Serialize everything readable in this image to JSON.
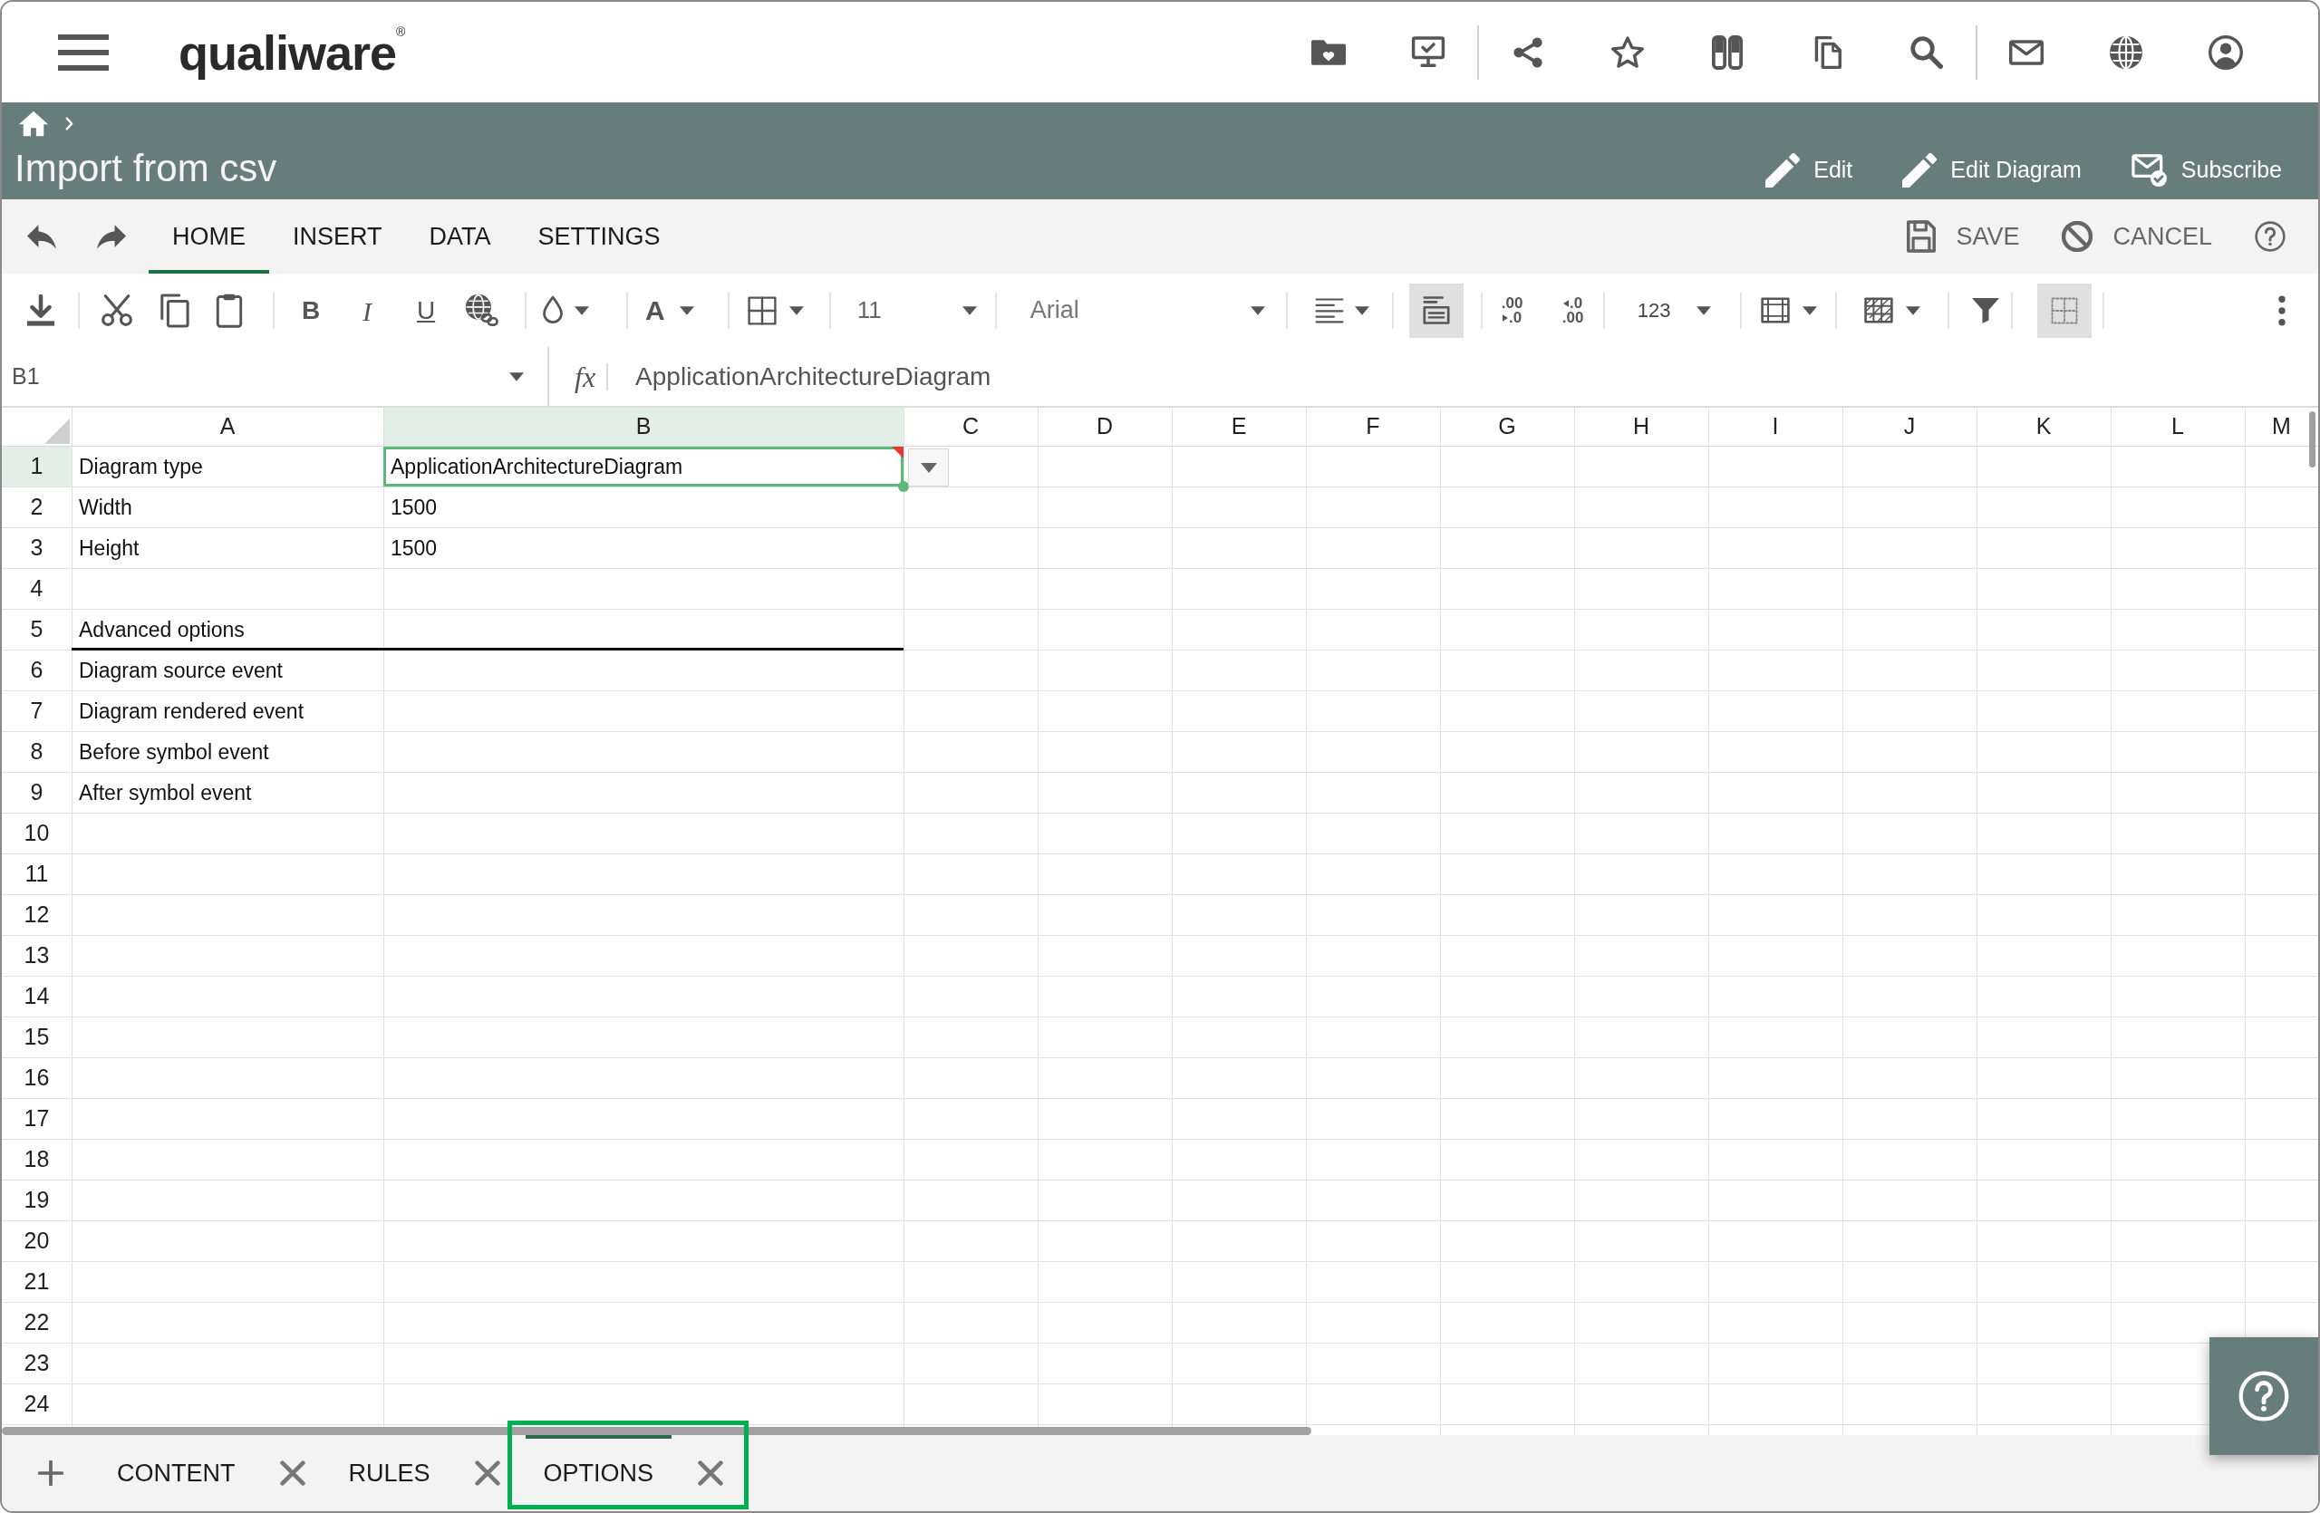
{
  "app_bar": {
    "logo": "qualiware$^{®}$"
  },
  "page_header": {
    "title": "Import from csv",
    "actions": [
      {
        "label": "Edit"
      },
      {
        "label": "Edit Diagram"
      },
      {
        "label": "Subscribe"
      }
    ]
  },
  "ribbon": {
    "tabs": [
      {
        "label": "HOME",
        "selected": true
      },
      {
        "label": "INSERT",
        "selected": false
      },
      {
        "label": "DATA",
        "selected": false
      },
      {
        "label": "SETTINGS",
        "selected": false
      }
    ],
    "actions": [
      {
        "label": "SAVE"
      },
      {
        "label": "CANCEL"
      }
    ]
  },
  "toolbar": {
    "bold": "B",
    "italic": "I",
    "underline": "U",
    "font_color": "A",
    "font_size": "11",
    "font_name": "Arial",
    "text_layout_toggle": {
      "on": true
    },
    "decimal_buttons": [
      {
        "top": ".00",
        "bottom": ".0"
      },
      {
        "top": ".0",
        "bottom": ".00"
      }
    ],
    "number_format": "123",
    "gridlines_toggle": {
      "on": true
    }
  },
  "formula_bar": {
    "cell_ref": "B1",
    "function_label": "fx",
    "formula": "ApplicationArchitectureDiagram"
  },
  "sheet": {
    "columns": [
      {
        "label": "A",
        "selected": false
      },
      {
        "label": "B",
        "selected": true
      },
      {
        "label": "C",
        "selected": false
      },
      {
        "label": "D",
        "selected": false
      },
      {
        "label": "E",
        "selected": false
      },
      {
        "label": "F",
        "selected": false
      },
      {
        "label": "G",
        "selected": false
      },
      {
        "label": "H",
        "selected": false
      },
      {
        "label": "I",
        "selected": false
      },
      {
        "label": "J",
        "selected": false
      },
      {
        "label": "K",
        "selected": false
      },
      {
        "label": "L",
        "selected": false
      },
      {
        "label": "M",
        "selected": false
      }
    ],
    "rows": [
      {
        "label": "1",
        "selected": true,
        "rule_below": false,
        "cells": [
          {
            "text": "Diagram type",
            "selected": false,
            "flagged": false,
            "dropdown": false
          },
          {
            "text": "ApplicationArchitectureDiagram",
            "selected": true,
            "flagged": true,
            "dropdown": true
          }
        ]
      },
      {
        "label": "2",
        "selected": false,
        "rule_below": false,
        "cells": [
          {
            "text": "Width",
            "selected": false,
            "flagged": false,
            "dropdown": false
          },
          {
            "text": "1500",
            "selected": false,
            "flagged": false,
            "dropdown": false
          }
        ]
      },
      {
        "label": "3",
        "selected": false,
        "rule_below": false,
        "cells": [
          {
            "text": "Height",
            "selected": false,
            "flagged": false,
            "dropdown": false
          },
          {
            "text": "1500",
            "selected": false,
            "flagged": false,
            "dropdown": false
          }
        ]
      },
      {
        "label": "4",
        "selected": false,
        "rule_below": false
      },
      {
        "label": "5",
        "selected": false,
        "rule_below": true,
        "cells": [
          {
            "text": "Advanced options",
            "selected": false,
            "flagged": false,
            "dropdown": false
          }
        ]
      },
      {
        "label": "6",
        "selected": false,
        "rule_below": false,
        "cells": [
          {
            "text": "Diagram source event",
            "selected": false,
            "flagged": false,
            "dropdown": false
          }
        ]
      },
      {
        "label": "7",
        "selected": false,
        "rule_below": false,
        "cells": [
          {
            "text": "Diagram rendered event",
            "selected": false,
            "flagged": false,
            "dropdown": false
          }
        ]
      },
      {
        "label": "8",
        "selected": false,
        "rule_below": false,
        "cells": [
          {
            "text": "Before symbol event",
            "selected": false,
            "flagged": false,
            "dropdown": false
          }
        ]
      },
      {
        "label": "9",
        "selected": false,
        "rule_below": false,
        "cells": [
          {
            "text": "After symbol event",
            "selected": false,
            "flagged": false,
            "dropdown": false
          }
        ]
      },
      {
        "label": "10",
        "selected": false,
        "rule_below": false
      },
      {
        "label": "11",
        "selected": false,
        "rule_below": false
      },
      {
        "label": "12",
        "selected": false,
        "rule_below": false
      },
      {
        "label": "13",
        "selected": false,
        "rule_below": false
      },
      {
        "label": "14",
        "selected": false,
        "rule_below": false
      },
      {
        "label": "15",
        "selected": false,
        "rule_below": false
      },
      {
        "label": "16",
        "selected": false,
        "rule_below": false
      },
      {
        "label": "17",
        "selected": false,
        "rule_below": false
      },
      {
        "label": "18",
        "selected": false,
        "rule_below": false
      },
      {
        "label": "19",
        "selected": false,
        "rule_below": false
      },
      {
        "label": "20",
        "selected": false,
        "rule_below": false
      },
      {
        "label": "21",
        "selected": false,
        "rule_below": false
      },
      {
        "label": "22",
        "selected": false,
        "rule_below": false
      },
      {
        "label": "23",
        "selected": false,
        "rule_below": false
      },
      {
        "label": "24",
        "selected": false,
        "rule_below": false
      }
    ]
  },
  "sheet_tabs": {
    "tabs": [
      {
        "label": "CONTENT",
        "selected": false,
        "highlighted": false
      },
      {
        "label": "RULES",
        "selected": false,
        "highlighted": false
      },
      {
        "label": "OPTIONS",
        "selected": true,
        "highlighted": true
      }
    ]
  }
}
